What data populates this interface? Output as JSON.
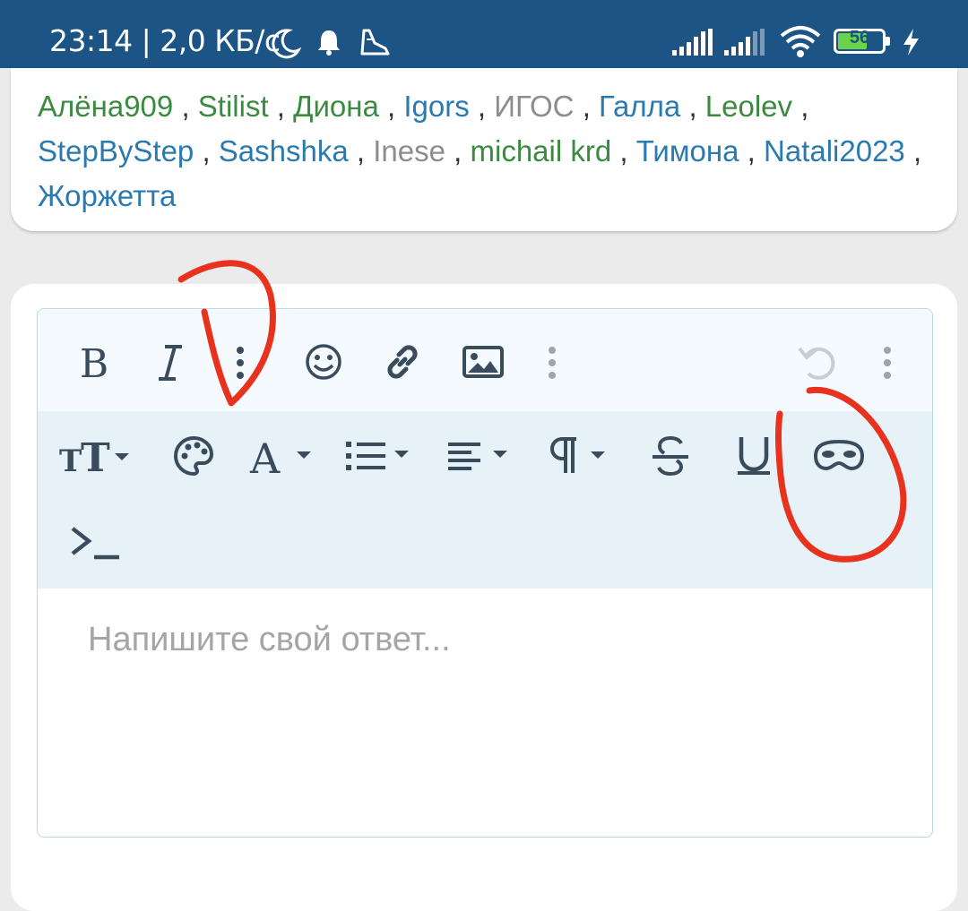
{
  "status_bar": {
    "time": "23:14",
    "separator": "|",
    "net_speed": "2,0 КБ/с",
    "battery_level": "56",
    "icons": [
      "moon-icon",
      "bell-icon",
      "shoe-icon",
      "signal-icon",
      "signal-icon-2",
      "wifi-icon",
      "battery-icon",
      "charging-icon"
    ]
  },
  "users": [
    {
      "name": "Алёна909",
      "color": "green"
    },
    {
      "name": "Stilist",
      "color": "green"
    },
    {
      "name": "Диона",
      "color": "green"
    },
    {
      "name": "Igors",
      "color": "blue"
    },
    {
      "name": "ИГОС",
      "color": "gray"
    },
    {
      "name": "Галла",
      "color": "blue"
    },
    {
      "name": "Leolev",
      "color": "green"
    },
    {
      "name": "StepByStep",
      "color": "blue"
    },
    {
      "name": "Sashshka",
      "color": "blue"
    },
    {
      "name": "Inese",
      "color": "gray"
    },
    {
      "name": "michail krd",
      "color": "green"
    },
    {
      "name": "Тимона",
      "color": "blue"
    },
    {
      "name": "Natali2023",
      "color": "blue"
    },
    {
      "name": "Жоржетта",
      "color": "blue"
    }
  ],
  "user_separator": ",",
  "editor": {
    "placeholder": "Напишите свой ответ...",
    "toolbar_primary": [
      "bold-icon",
      "italic-icon",
      "more-vertical-icon",
      "smile-icon",
      "link-icon",
      "image-icon",
      "more-vertical-icon",
      "undo-icon",
      "more-vertical-icon"
    ],
    "toolbar_secondary": [
      "text-size-icon",
      "palette-icon",
      "font-color-icon",
      "list-icon",
      "align-icon",
      "paragraph-icon",
      "strikethrough-icon",
      "underline-icon",
      "spoiler-mask-icon",
      "code-terminal-icon"
    ]
  },
  "colors": {
    "status_bar": "#1c5486",
    "user_green": "#3a8a40",
    "user_blue": "#2a7ab0",
    "user_gray": "#8d8d8d",
    "annotation": "#e8321e"
  }
}
